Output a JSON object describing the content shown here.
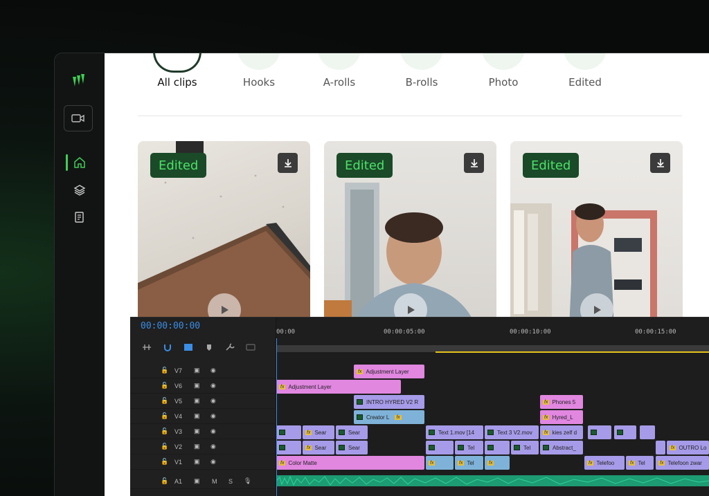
{
  "categories": [
    {
      "label": "All clips",
      "active": true
    },
    {
      "label": "Hooks"
    },
    {
      "label": "A-rolls"
    },
    {
      "label": "B-rolls"
    },
    {
      "label": "Photo"
    },
    {
      "label": "Edited"
    }
  ],
  "cards": [
    {
      "badge": "Edited"
    },
    {
      "badge": "Edited"
    },
    {
      "badge": "Edited"
    }
  ],
  "timeline": {
    "timecode": "00:00:00:00",
    "ruler": [
      "00:00",
      "00:00:05:00",
      "00:00:10:00",
      "00:00:15:00"
    ],
    "tracks": [
      {
        "name": "V7"
      },
      {
        "name": "V6"
      },
      {
        "name": "V5"
      },
      {
        "name": "V4"
      },
      {
        "name": "V3"
      },
      {
        "name": "V2"
      },
      {
        "name": "V1"
      },
      {
        "name": "A1"
      }
    ],
    "clips": {
      "v7_adj": "Adjustment Layer",
      "v6_adj": "Adjustment Layer",
      "v5_intro": "INTRO HYRED V2 R",
      "v5_phones": "Phones 5",
      "v4_creator": "Creator L",
      "v4_hyred": "Hyred_L",
      "v3_sear1": "Sear",
      "v3_sear2": "Sear",
      "v3_text1": "Text 1.mov [14",
      "v3_text3": "Text 3 V2.mov",
      "v3_kies": "kies zelf d",
      "v2_sear1": "Sear",
      "v2_sear2": "Sear",
      "v2_tel1": "Tel",
      "v2_tel2": "Tel",
      "v2_abstract": "Abstract_",
      "v2_outro": "OUTRO Lo",
      "v1_color": "Color Matte",
      "v1_tel": "Tel",
      "v1_telefoo": "Telefoo",
      "v1_tel2": "Tel",
      "v1_telefoon": "Telefoon zwar"
    },
    "audio_labels": {
      "m": "M",
      "s": "S"
    }
  },
  "colors": {
    "accent": "#3ecf56",
    "badge_bg": "#1a4a28",
    "timecode": "#3a8ee6"
  }
}
